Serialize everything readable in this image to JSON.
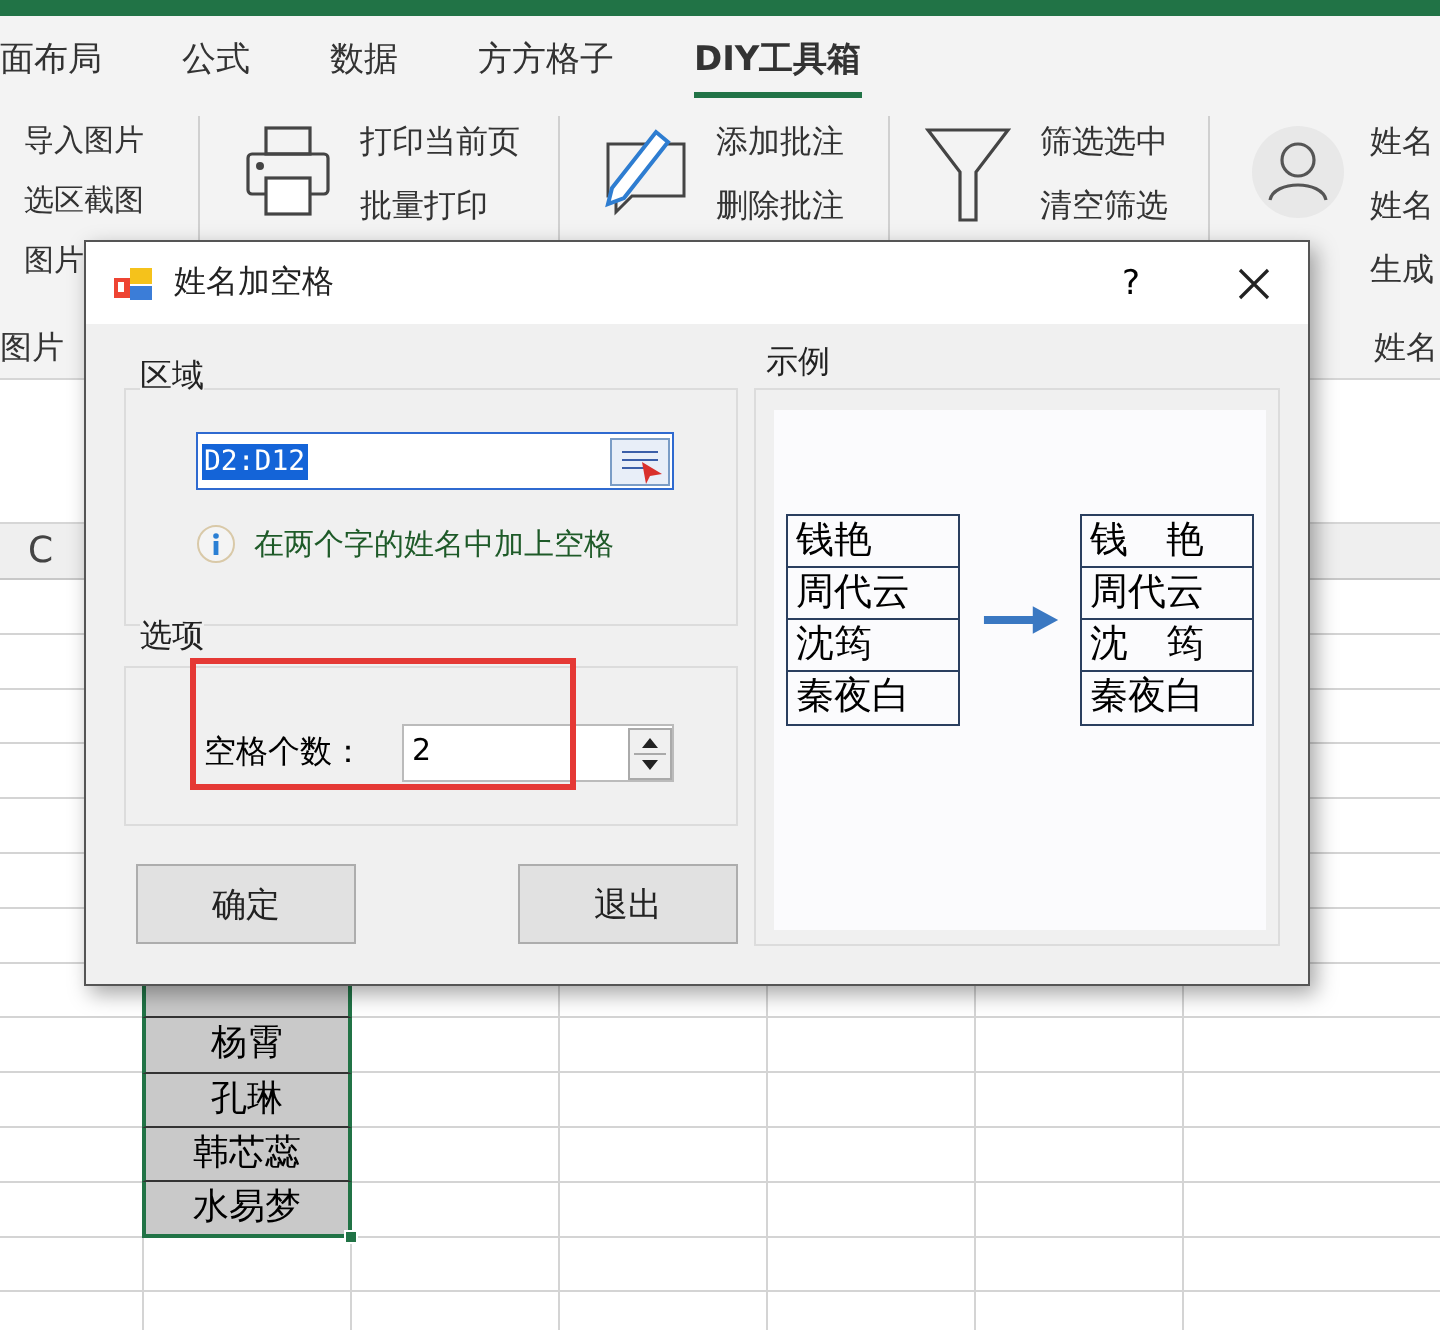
{
  "ribbon_tabs": [
    {
      "label": "面布局",
      "selected": false
    },
    {
      "label": "公式",
      "selected": false
    },
    {
      "label": "数据",
      "selected": false
    },
    {
      "label": "方方格子",
      "selected": false
    },
    {
      "label": "DIY工具箱",
      "selected": true
    }
  ],
  "ribbon_groups": [
    {
      "items": [
        "导入图片",
        "选区截图",
        "图片"
      ],
      "label": "图片"
    },
    {
      "items": [
        "打印当前页",
        "批量打印"
      ]
    },
    {
      "items": [
        "添加批注",
        "删除批注"
      ]
    },
    {
      "items": [
        "筛选选中",
        "清空筛选"
      ]
    },
    {
      "items": [
        "姓名",
        "姓名",
        "生成"
      ],
      "label": "姓名"
    }
  ],
  "sheet": {
    "column_header": "C",
    "rows": [
      {
        "selected": true
      },
      {
        "selected": true,
        "d": "杨霄"
      },
      {
        "selected": true,
        "d": "孔琳"
      },
      {
        "selected": true,
        "d": "韩芯蕊"
      },
      {
        "selected": true,
        "d": "水易梦"
      },
      {
        "selected": false
      },
      {
        "selected": false
      }
    ]
  },
  "dialog": {
    "title": "姓名加空格",
    "help": "?",
    "range_group": {
      "legend": "区域",
      "value": "D2:D12",
      "highlighted": true,
      "hint": "在两个字的姓名中加上空格"
    },
    "options_group": {
      "legend": "选项",
      "label": "空格个数：",
      "value": "2"
    },
    "buttons": [
      "确定",
      "退出"
    ],
    "example": {
      "legend": "示例",
      "before": [
        "钱艳",
        "周代云",
        "沈筠",
        "秦夜白"
      ],
      "after": [
        "钱　艳",
        "周代云",
        "沈　筠",
        "秦夜白"
      ]
    }
  }
}
